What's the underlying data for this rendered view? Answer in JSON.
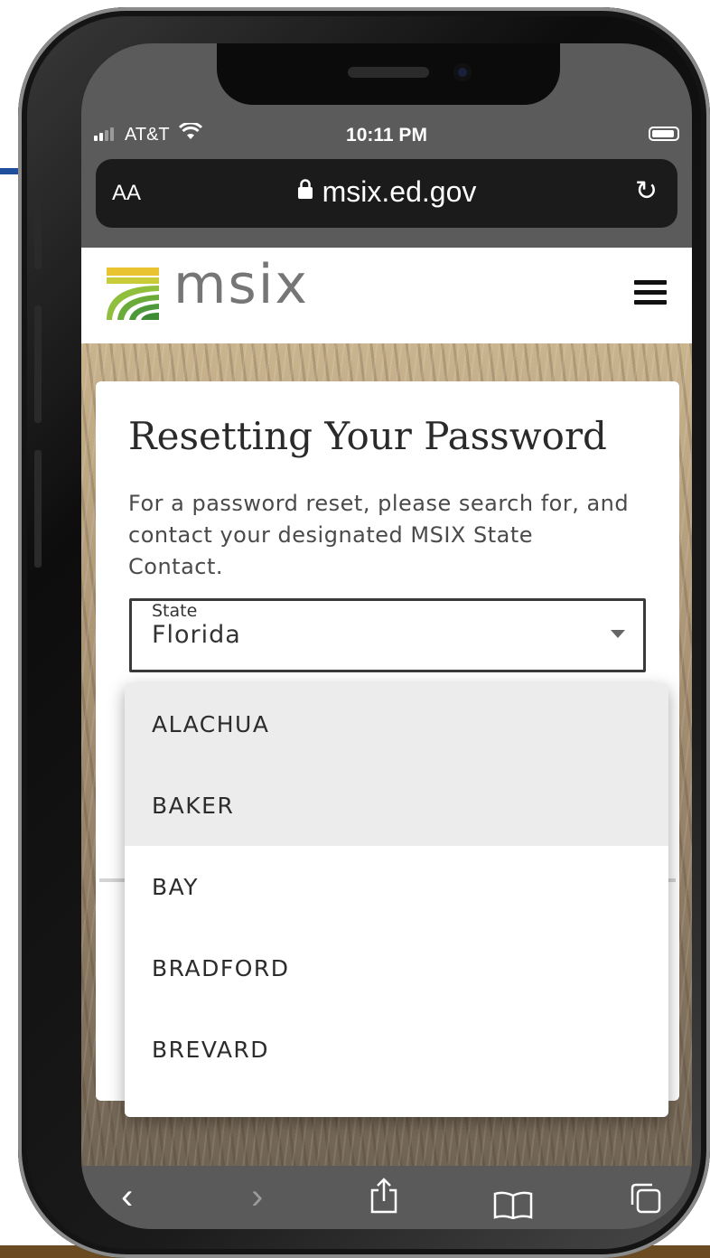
{
  "status_bar": {
    "carrier": "AT&T",
    "time": "10:11 PM"
  },
  "browser": {
    "text_size_label": "AA",
    "url": "msix.ed.gov"
  },
  "site": {
    "logo_text": "msix",
    "brand_colors": {
      "green": "#4e9a3b",
      "yellow": "#e9c430",
      "text": "#767676"
    }
  },
  "card": {
    "title": "Resetting Your Password",
    "description": "For a password reset, please search for, and contact your designated MSIX State Contact.",
    "state_field": {
      "label": "State",
      "value": "Florida"
    }
  },
  "dropdown": {
    "options": [
      "ALACHUA",
      "BAKER",
      "BAY",
      "BRADFORD",
      "BREVARD"
    ]
  },
  "toolbar": {
    "icons": [
      "back-icon",
      "forward-icon",
      "share-icon",
      "bookmarks-icon",
      "tabs-icon"
    ]
  }
}
